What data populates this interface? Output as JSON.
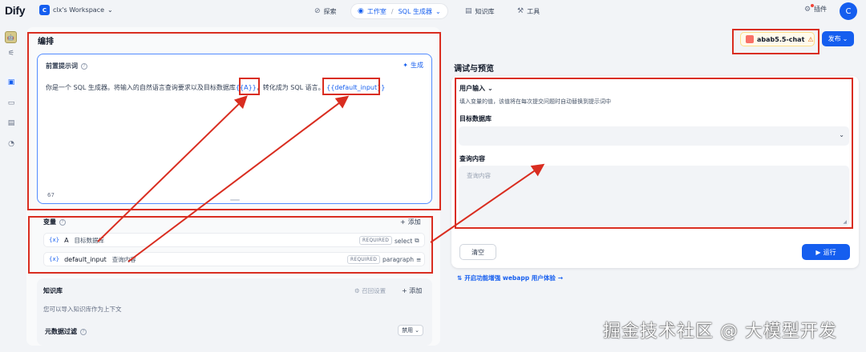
{
  "header": {
    "logo": "Dify",
    "workspace_badge": "C",
    "workspace_name": "clx's Workspace",
    "nav": {
      "explore": "探索",
      "studio": "工作室",
      "app_name": "SQL 生成器",
      "knowledge": "知识库",
      "tools": "工具"
    },
    "plugins": "插件",
    "avatar": "C"
  },
  "rail": {
    "app_icon": "🤖"
  },
  "orchestrate": {
    "title": "编排",
    "prompt": {
      "title": "前置提示词",
      "generate": "生成",
      "text_before": "你是一个 SQL 生成器。将输入的自然语言查询要求以及目标数据库",
      "var_a": "{{A}}",
      "text_middle": "，转化成为 SQL 语言。",
      "var_default": "{{default_input}}",
      "char_count": "67"
    },
    "variables": {
      "title": "变量",
      "add": "添加",
      "items": [
        {
          "key": "A",
          "name": "目标数据库",
          "required": "REQUIRED",
          "type": "select"
        },
        {
          "key": "default_input",
          "name": "查询内容",
          "required": "REQUIRED",
          "type": "paragraph"
        }
      ]
    },
    "knowledge": {
      "title": "知识库",
      "settings": "召回设置",
      "add": "添加",
      "hint": "您可以导入知识库作为上下文",
      "metadata_title": "元数据过滤",
      "metadata_value": "禁用"
    }
  },
  "toolbar": {
    "model": "abab5.5-chat",
    "publish": "发布"
  },
  "debug": {
    "title": "调试与预览",
    "user_input": "用户输入",
    "hint": "填入变量的值，该值将在每次提交问题时自动替换到提示词中",
    "field1_label": "目标数据库",
    "field2_label": "查询内容",
    "field2_placeholder": "查询内容",
    "clear": "清空",
    "run": "运行",
    "feature_link": "开启功能增强 webapp 用户体验"
  },
  "watermark": "掘金技术社区 @ 大模型开发",
  "colors": {
    "accent": "#155eef",
    "annotation_red": "#d92d20",
    "warning": "#dc6803"
  }
}
